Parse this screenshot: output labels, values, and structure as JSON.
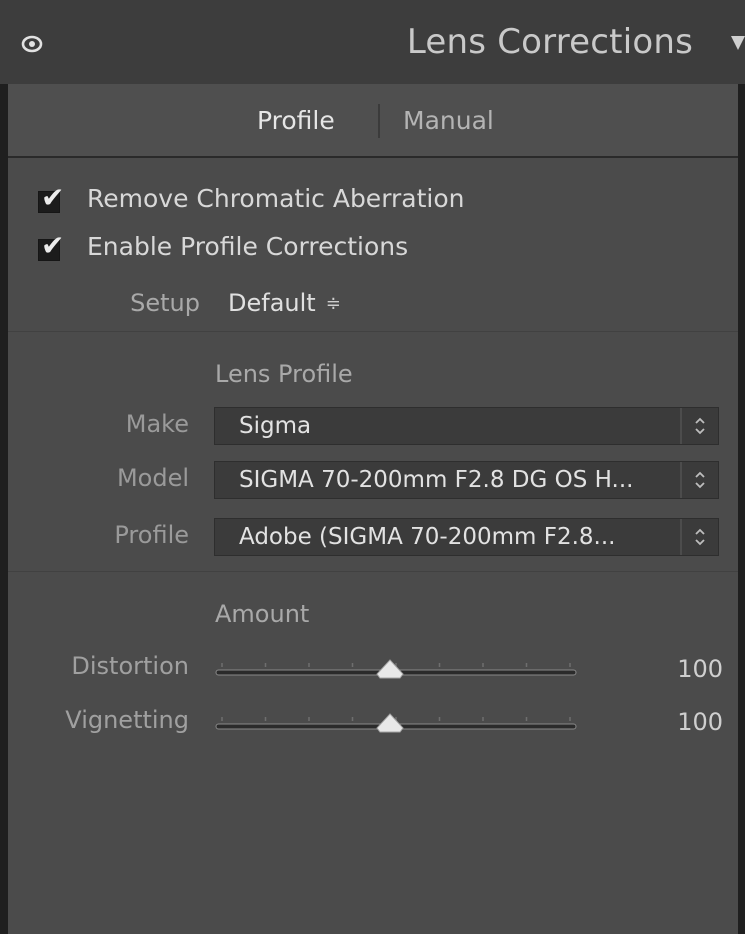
{
  "header": {
    "title": "Lens Corrections",
    "icon_left": "eye-icon",
    "icon_right": "collapse-triangle-icon"
  },
  "tabs": [
    {
      "label": "Profile",
      "active": true
    },
    {
      "label": "Manual",
      "active": false
    }
  ],
  "checkboxes": [
    {
      "label": "Remove Chromatic Aberration",
      "checked": true
    },
    {
      "label": "Enable Profile Corrections",
      "checked": true
    }
  ],
  "setup": {
    "label": "Setup",
    "value": "Default",
    "arrows": "≑"
  },
  "lens_profile": {
    "title": "Lens Profile",
    "make": {
      "label": "Make",
      "value": "Sigma"
    },
    "model": {
      "label": "Model",
      "value": "SIGMA 70-200mm F2.8 DG OS H..."
    },
    "profile": {
      "label": "Profile",
      "value": "Adobe (SIGMA 70-200mm F2.8..."
    }
  },
  "amount": {
    "title": "Amount",
    "distortion": {
      "label": "Distortion",
      "value": "100",
      "level": 0.5
    },
    "vignetting": {
      "label": "Vignetting",
      "value": "100",
      "level": 0.5
    }
  },
  "colors": {
    "panel_bg": "#4b4b4b",
    "header_bg": "#3d3d3d",
    "text_primary": "#e0e0e0",
    "text_secondary": "#9a9a9a"
  }
}
